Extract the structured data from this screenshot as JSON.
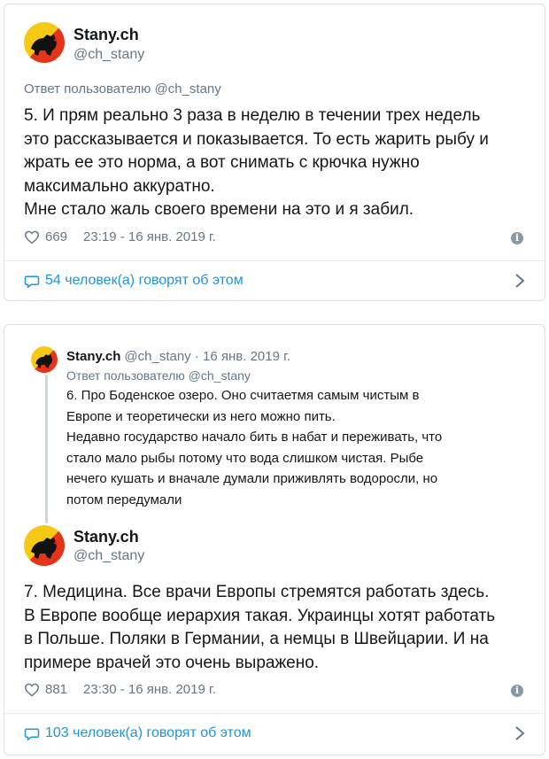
{
  "tweet1": {
    "name": "Stany.ch",
    "handle": "@ch_stany",
    "reply_prefix": "Ответ пользователю ",
    "reply_to": "@ch_stany",
    "text": "5. И прям реально 3 раза в неделю в течении трех недель\nэто рассказывается и показывается. То есть жарить рыбу и\nжрать ее это норма, а вот снимать с крючка нужно\nмаксимально аккуратно.\nМне стало жаль своего времени на это и я забил.",
    "likes": "669",
    "timestamp": "23:19 - 16 янв. 2019 г.",
    "conversation": "54 человек(а) говорят об этом"
  },
  "tweet2": {
    "parent": {
      "name": "Stany.ch",
      "handle": "@ch_stany",
      "separator": " · ",
      "date": "16 янв. 2019 г.",
      "reply_prefix": "Ответ пользователю ",
      "reply_to": "@ch_stany",
      "text": "6. Про Боденское озеро. Оно считаетмя самым чистым в\nЕвропе и теоретически из него можно пить.\nНедавно государство начало бить в набат и переживать, что\nстало мало рыбы потому что вода слишком чистая. Рыбе\nнечего кушать и вначале думали приживлять водоросли, но\nпотом передумали"
    },
    "name": "Stany.ch",
    "handle": "@ch_stany",
    "text": "7. Медицина.  Все врачи Европы стремятся работать здесь.\nВ Европе вообще иерархия такая. Украинцы хотят работать\nв Польше. Поляки в Германии, а немцы в Швейцарии. И на\nпримере врачей это очень выражено.",
    "likes": "881",
    "timestamp": "23:30 - 16 янв. 2019 г.",
    "conversation": "103 человек(а) говорят об этом"
  },
  "colors": {
    "link_blue": "#1b95e0",
    "muted_gray": "#657786",
    "border": "#d9e0e6",
    "avatar_yellow": "#f6c914",
    "avatar_red": "#e2231a"
  },
  "icons": [
    "bern-bear-avatar-icon",
    "heart-icon",
    "info-icon",
    "reply-bubble-icon",
    "chevron-right-icon"
  ]
}
